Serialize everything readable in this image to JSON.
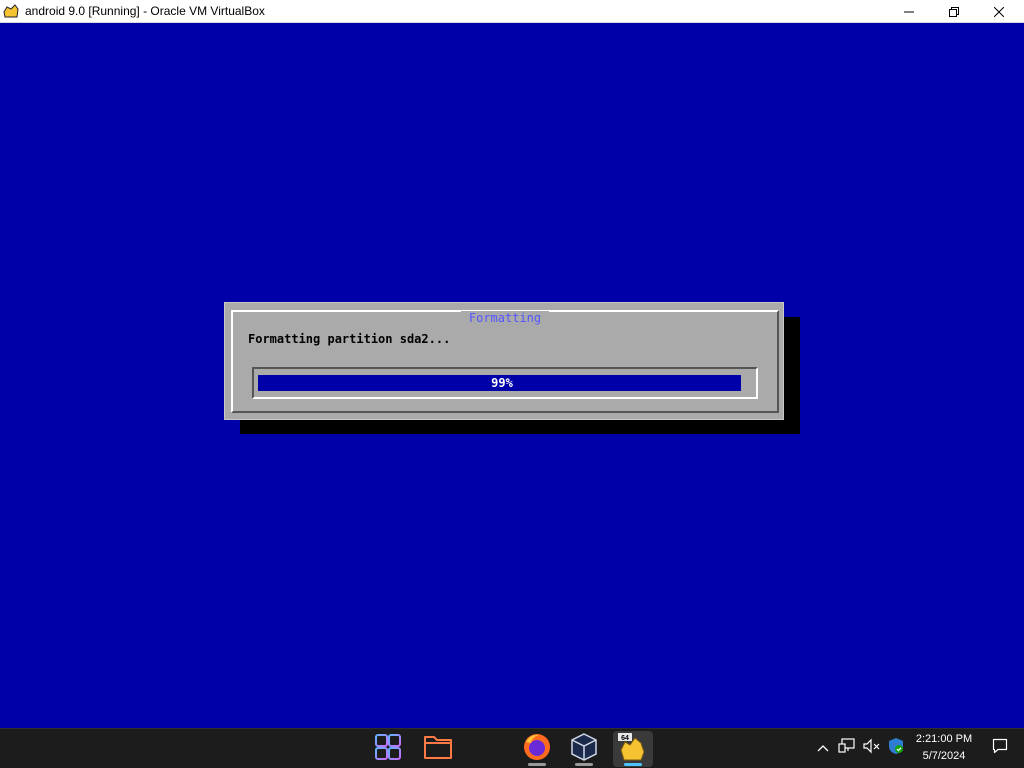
{
  "window": {
    "title": "android 9.0 [Running] - Oracle VM VirtualBox",
    "controls": {
      "minimize": "minimize-icon",
      "maximize": "restore-icon",
      "close": "close-icon"
    }
  },
  "dialog": {
    "title": "Formatting",
    "message": "Formatting partition sda2...",
    "progress": {
      "percent": 99,
      "label": "99%"
    }
  },
  "taskbar": {
    "pinned": [
      {
        "name": "start-icon"
      },
      {
        "name": "file-explorer-icon"
      },
      {
        "name": "firefox-icon"
      },
      {
        "name": "virtualbox-icon"
      },
      {
        "name": "virtualbox-vm-icon",
        "badge": "64",
        "active": true
      }
    ],
    "tray": [
      "chevron-up-icon",
      "network-icon",
      "volume-muted-icon",
      "security-icon"
    ],
    "clock": {
      "time": "2:21:00 PM",
      "date": "5/7/2024"
    },
    "notifications": "notification-icon"
  },
  "colors": {
    "vm_background": "#0000a8",
    "dialog_background": "#aaaaaa",
    "dialog_title": "#5555ff",
    "progress_fill": "#0000a8"
  }
}
